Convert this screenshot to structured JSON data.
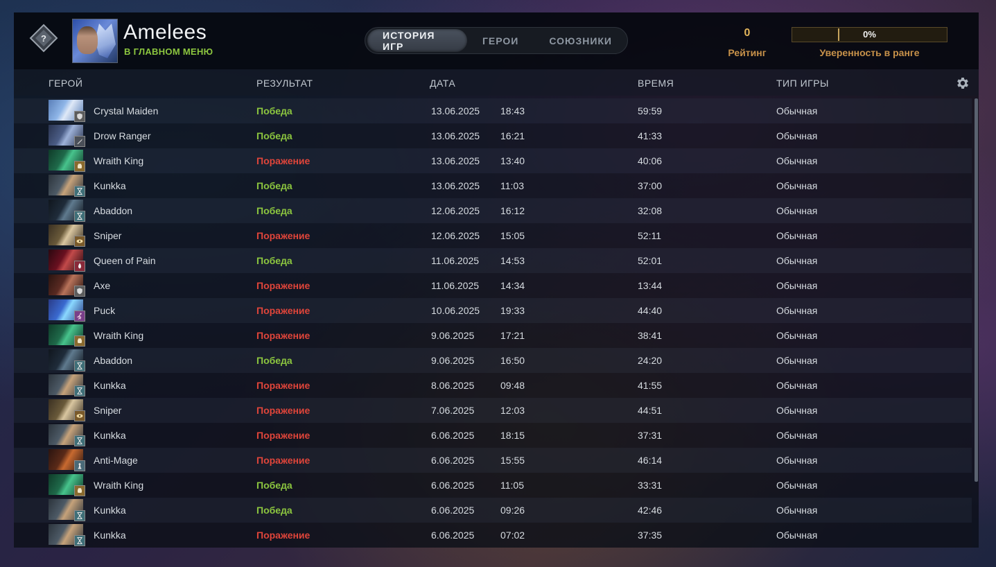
{
  "profile": {
    "name": "Amelees",
    "status": "В ГЛАВНОМ МЕНЮ"
  },
  "tabs": [
    {
      "label": "ИСТОРИЯ ИГР",
      "active": true
    },
    {
      "label": "ГЕРОИ",
      "active": false
    },
    {
      "label": "СОЮЗНИКИ",
      "active": false
    }
  ],
  "rating": {
    "value": "0",
    "label": "Рейтинг"
  },
  "rank_confidence": {
    "value": "0%",
    "label": "Уверенность в ранге"
  },
  "columns": {
    "hero": "ГЕРОЙ",
    "result": "РЕЗУЛЬТАТ",
    "date": "ДАТА",
    "duration": "ВРЕМЯ",
    "mode": "ТИП ИГРЫ"
  },
  "colors": {
    "win": "#8cc63f",
    "loss": "#e0453a",
    "accent_gold": "#c8924a"
  },
  "matches": [
    {
      "hero": "Crystal Maiden",
      "result": "Победа",
      "win": true,
      "date": "13.06.2025",
      "time": "18:43",
      "duration": "59:59",
      "mode": "Обычная",
      "role_icon": "shield-icon"
    },
    {
      "hero": "Drow Ranger",
      "result": "Победа",
      "win": true,
      "date": "13.06.2025",
      "time": "16:21",
      "duration": "41:33",
      "mode": "Обычная",
      "role_icon": "sword-icon"
    },
    {
      "hero": "Wraith King",
      "result": "Поражение",
      "win": false,
      "date": "13.06.2025",
      "time": "13:40",
      "duration": "40:06",
      "mode": "Обычная",
      "role_icon": "fist-icon"
    },
    {
      "hero": "Kunkka",
      "result": "Победа",
      "win": true,
      "date": "13.06.2025",
      "time": "11:03",
      "duration": "37:00",
      "mode": "Обычная",
      "role_icon": "hourglass-icon"
    },
    {
      "hero": "Abaddon",
      "result": "Победа",
      "win": true,
      "date": "12.06.2025",
      "time": "16:12",
      "duration": "32:08",
      "mode": "Обычная",
      "role_icon": "hourglass-icon"
    },
    {
      "hero": "Sniper",
      "result": "Поражение",
      "win": false,
      "date": "12.06.2025",
      "time": "15:05",
      "duration": "52:11",
      "mode": "Обычная",
      "role_icon": "eye-icon"
    },
    {
      "hero": "Queen of Pain",
      "result": "Победа",
      "win": true,
      "date": "11.06.2025",
      "time": "14:53",
      "duration": "52:01",
      "mode": "Обычная",
      "role_icon": "fire-icon"
    },
    {
      "hero": "Axe",
      "result": "Поражение",
      "win": false,
      "date": "11.06.2025",
      "time": "14:34",
      "duration": "13:44",
      "mode": "Обычная",
      "role_icon": "shield-icon"
    },
    {
      "hero": "Puck",
      "result": "Поражение",
      "win": false,
      "date": "10.06.2025",
      "time": "19:33",
      "duration": "44:40",
      "mode": "Обычная",
      "role_icon": "runner-icon"
    },
    {
      "hero": "Wraith King",
      "result": "Поражение",
      "win": false,
      "date": "9.06.2025",
      "time": "17:21",
      "duration": "38:41",
      "mode": "Обычная",
      "role_icon": "fist-icon"
    },
    {
      "hero": "Abaddon",
      "result": "Победа",
      "win": true,
      "date": "9.06.2025",
      "time": "16:50",
      "duration": "24:20",
      "mode": "Обычная",
      "role_icon": "hourglass-icon"
    },
    {
      "hero": "Kunkka",
      "result": "Поражение",
      "win": false,
      "date": "8.06.2025",
      "time": "09:48",
      "duration": "41:55",
      "mode": "Обычная",
      "role_icon": "hourglass-icon"
    },
    {
      "hero": "Sniper",
      "result": "Поражение",
      "win": false,
      "date": "7.06.2025",
      "time": "12:03",
      "duration": "44:51",
      "mode": "Обычная",
      "role_icon": "eye-icon"
    },
    {
      "hero": "Kunkka",
      "result": "Поражение",
      "win": false,
      "date": "6.06.2025",
      "time": "18:15",
      "duration": "37:31",
      "mode": "Обычная",
      "role_icon": "hourglass-icon"
    },
    {
      "hero": "Anti-Mage",
      "result": "Поражение",
      "win": false,
      "date": "6.06.2025",
      "time": "15:55",
      "duration": "46:14",
      "mode": "Обычная",
      "role_icon": "chess-icon"
    },
    {
      "hero": "Wraith King",
      "result": "Победа",
      "win": true,
      "date": "6.06.2025",
      "time": "11:05",
      "duration": "33:31",
      "mode": "Обычная",
      "role_icon": "fist-icon"
    },
    {
      "hero": "Kunkka",
      "result": "Победа",
      "win": true,
      "date": "6.06.2025",
      "time": "09:26",
      "duration": "42:46",
      "mode": "Обычная",
      "role_icon": "hourglass-icon"
    },
    {
      "hero": "Kunkka",
      "result": "Поражение",
      "win": false,
      "date": "6.06.2025",
      "time": "07:02",
      "duration": "37:35",
      "mode": "Обычная",
      "role_icon": "hourglass-icon"
    }
  ]
}
